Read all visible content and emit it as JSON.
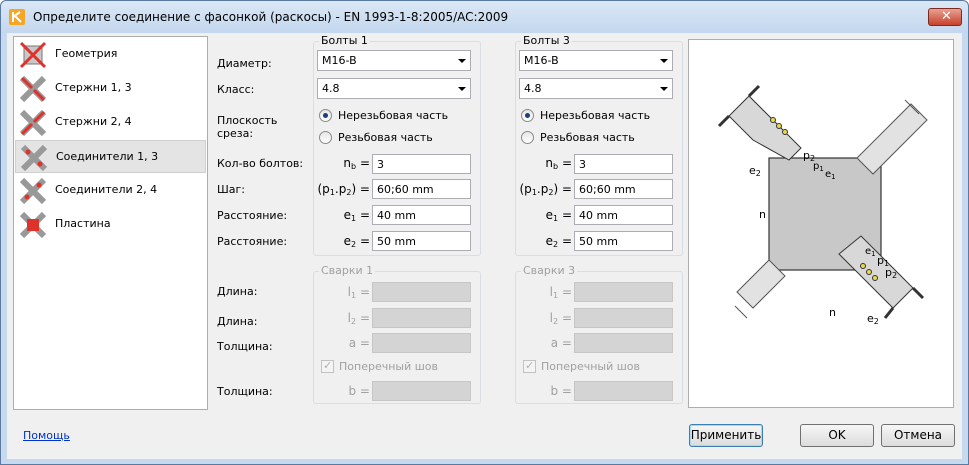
{
  "window": {
    "title": "Определите соединение с фасонкой (раскосы)  - EN 1993-1-8:2005/AC:2009",
    "close_glyph": "✕"
  },
  "sidebar": {
    "items": [
      {
        "label": "Геометрия",
        "icon": "geometry-icon",
        "selected": false
      },
      {
        "label": "Стержни 1, 3",
        "icon": "members-icon",
        "selected": false
      },
      {
        "label": "Стержни 2, 4",
        "icon": "members-icon",
        "selected": false
      },
      {
        "label": "Соединители 1, 3",
        "icon": "connectors-icon",
        "selected": true
      },
      {
        "label": "Соединители 2, 4",
        "icon": "connectors-icon",
        "selected": false
      },
      {
        "label": "Пластина",
        "icon": "plate-icon",
        "selected": false
      }
    ]
  },
  "labels": {
    "diameter": "Диаметр:",
    "class": "Класс:",
    "shear_plane_1": "Плоскость",
    "shear_plane_2": "среза:",
    "bolt_count": "Кол-во болтов:",
    "pitch": "Шаг:",
    "distance_1": "Расстояние:",
    "distance_2": "Расстояние:",
    "length_1": "Длина:",
    "length_2": "Длина:",
    "thickness_1": "Толщина:",
    "thickness_2": "Толщина:"
  },
  "bolts1": {
    "title": "Болты 1",
    "diameter": "M16-B",
    "class": "4.8",
    "radio_unthreaded": "Нерезьбовая часть",
    "radio_threaded": "Резьбовая часть",
    "nb": "3",
    "p": "60;60 mm",
    "e1": "40 mm",
    "e2": "50 mm"
  },
  "bolts3": {
    "title": "Болты 3",
    "diameter": "M16-B",
    "class": "4.8",
    "radio_unthreaded": "Нерезьбовая часть",
    "radio_threaded": "Резьбовая часть",
    "nb": "3",
    "p": "60;60 mm",
    "e1": "40 mm",
    "e2": "50 mm"
  },
  "welds1": {
    "title": "Сварки 1",
    "transverse": "Поперечный шов"
  },
  "welds3": {
    "title": "Сварки 3",
    "transverse": "Поперечный шов"
  },
  "symbols": {
    "nb_main": "n",
    "nb_sub": "b",
    "eq": "=",
    "p_open": "(p",
    "p_sub1": "1",
    "p_mid": ".p",
    "p_sub2": "2",
    "p_close": ") =",
    "e": "e",
    "e1_sub": "1",
    "e2_sub": "2",
    "l": "l",
    "l1_sub": "1",
    "l2_sub": "2",
    "a": "a =",
    "b": "b ="
  },
  "preview": {
    "labels": {
      "p2": "p",
      "p1": "p",
      "e1": "e",
      "e2": "e",
      "n": "n",
      "sub1": "1",
      "sub2": "2"
    }
  },
  "buttons": {
    "help": "Помощь",
    "apply": "Применить",
    "ok": "OK",
    "cancel": "Отмена"
  },
  "colors": {
    "accent_x": "#e0322a",
    "selection": "#e4e4e4",
    "plate": "#c8c8c8",
    "bolt": "#e8d84a"
  }
}
